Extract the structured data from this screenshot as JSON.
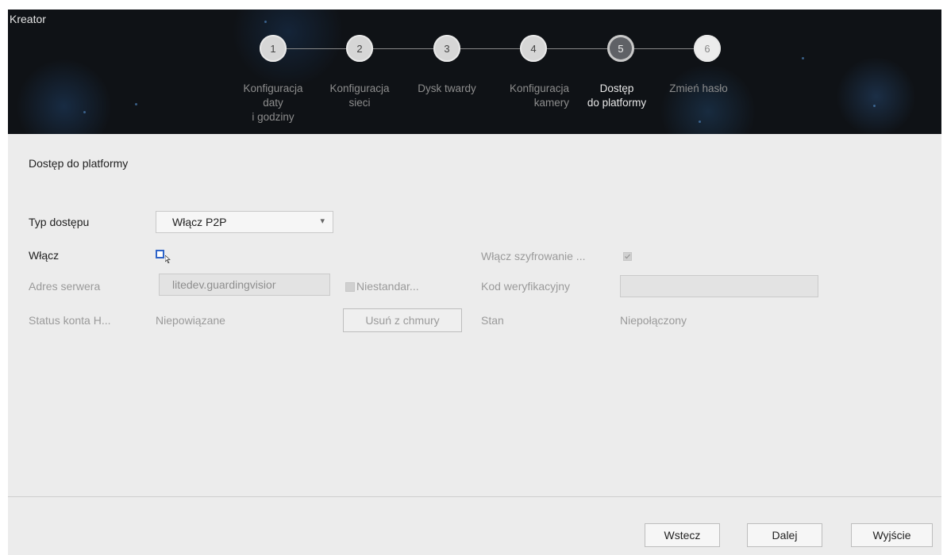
{
  "window": {
    "title": "Kreator"
  },
  "steps": [
    {
      "number": "1",
      "label": "Konfiguracja\ndaty\ni godziny",
      "state": "done"
    },
    {
      "number": "2",
      "label": "Konfiguracja\nsieci",
      "state": "done"
    },
    {
      "number": "3",
      "label": "Dysk twardy",
      "state": "done"
    },
    {
      "number": "4",
      "label": "Konfiguracja\nkamery",
      "state": "done"
    },
    {
      "number": "5",
      "label": "Dostęp\ndo platformy",
      "state": "active"
    },
    {
      "number": "6",
      "label": "Zmień hasło",
      "state": "future"
    }
  ],
  "section": {
    "title": "Dostęp do platformy"
  },
  "form": {
    "access_type": {
      "label": "Typ dostępu",
      "value": "Włącz P2P"
    },
    "enable": {
      "label": "Włącz",
      "checked": false
    },
    "encryption": {
      "label": "Włącz szyfrowanie ...",
      "checked": true
    },
    "server_address": {
      "label": "Adres serwera",
      "value": "litedev.guardingvisior"
    },
    "nonstandard": {
      "label": "Niestandar...",
      "checked": false
    },
    "verification_code": {
      "label": "Kod weryfikacyjny",
      "value": ""
    },
    "account_status": {
      "label": "Status konta H...",
      "value": "Niepowiązane"
    },
    "remove_cloud_button": "Usuń z chmury",
    "state": {
      "label": "Stan",
      "value": "Niepołączony"
    }
  },
  "footer": {
    "back_button": "Wstecz",
    "next_button": "Dalej",
    "exit_button": "Wyjście"
  },
  "colors": {
    "header_bg": "#0f1216",
    "panel_bg": "#ececec",
    "checkbox_accent": "#2f64c8"
  },
  "icons": {
    "dropdown": "chevron-down-icon",
    "cursor": "mouse-pointer-icon"
  }
}
